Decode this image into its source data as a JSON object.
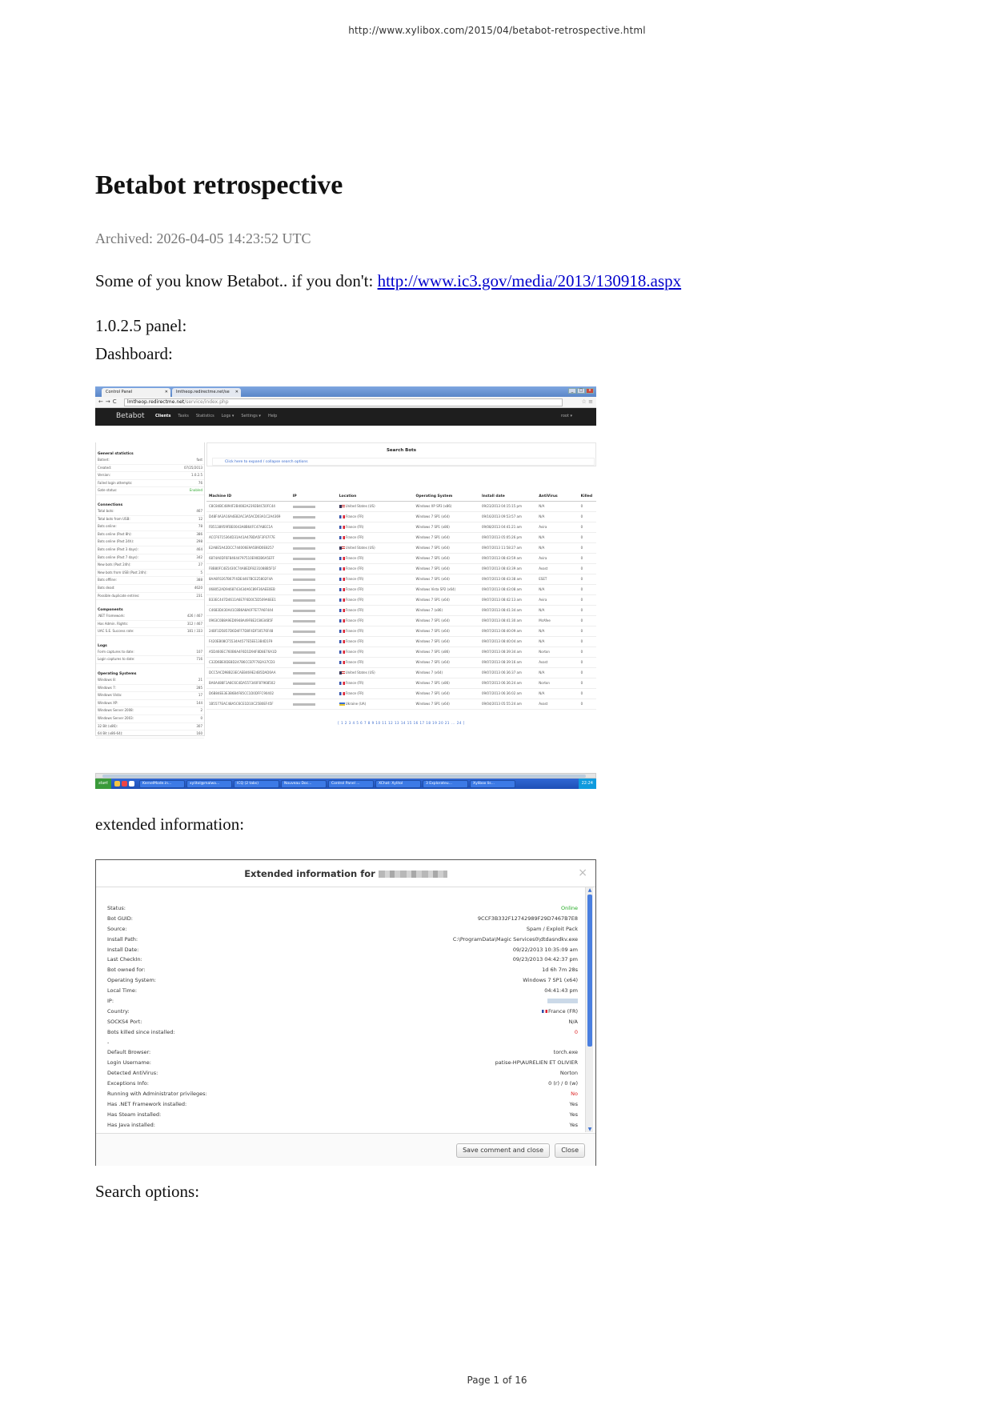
{
  "page": {
    "url": "http://www.xylibox.com/2015/04/betabot-retrospective.html",
    "footer": "Page 1 of 16"
  },
  "article": {
    "title": "Betabot retrospective",
    "archived": "Archived: 2026-04-05 14:23:52 UTC",
    "intro_text": "Some of you know Betabot.. if you don't: ",
    "intro_link": "http://www.ic3.gov/media/2013/130918.aspx",
    "panel_label": "1.0.2.5 panel:",
    "dashboard_label": "Dashboard:",
    "extended_label": "extended information:",
    "search_label": "Search options:"
  },
  "dashboard": {
    "tabs": [
      "Control Panel",
      "lmtheop.redirectme.net/se"
    ],
    "address_host": "lmtheop.redirectme.net",
    "address_path": "/service/index.php",
    "brand": "Betabot",
    "menu": [
      "Clients",
      "Tasks",
      "Statistics",
      "Logs ▾",
      "Settings ▾",
      "Help"
    ],
    "user": "root ▾",
    "stats": [
      {
        "heading": "General statistics",
        "rows": [
          [
            "Botnet:",
            "fast"
          ],
          [
            "Created:",
            "07/25/2013"
          ],
          [
            "Version:",
            "1.0.2.5"
          ],
          [
            "Failed login attempts:",
            "76"
          ],
          [
            "Gate status:",
            "Enabled"
          ]
        ]
      },
      {
        "heading": "Connections",
        "rows": [
          [
            "Total bots:",
            "467"
          ],
          [
            "Total bots from USB:",
            "12"
          ],
          [
            "Bots online:",
            "78"
          ],
          [
            "Bots online (Past 8h):",
            "386"
          ],
          [
            "Bots online (Past 24h):",
            "298"
          ],
          [
            "Bots online (Past 3 days):",
            "464"
          ],
          [
            "Bots online (Past 7 days):",
            "342"
          ],
          [
            "New bots (Past 24h):",
            "27"
          ],
          [
            "New bots from USB (Past 24h):",
            "5"
          ],
          [
            "Bots offline:",
            "388"
          ],
          [
            "Bots dead:",
            "4620"
          ],
          [
            "Possible duplicate entries:",
            "231"
          ]
        ]
      },
      {
        "heading": "Components",
        "rows": [
          [
            ".NET Framework:",
            "426 / 467"
          ],
          [
            "Has Admin. Rights:",
            "312 / 467"
          ],
          [
            "UAC S.E. Success rate:",
            "181 / 333"
          ]
        ]
      },
      {
        "heading": "Logs",
        "rows": [
          [
            "Form captures to date:",
            "107"
          ],
          [
            "Login captures to date:",
            "716"
          ]
        ]
      },
      {
        "heading": "Operating Systems",
        "rows": [
          [
            "Windows 8:",
            "21"
          ],
          [
            "Windows 7:",
            "285"
          ],
          [
            "Windows Vista:",
            "17"
          ],
          [
            "Windows XP:",
            "144"
          ],
          [
            "Windows Server 2008:",
            "2"
          ],
          [
            "Windows Server 2003:",
            "0"
          ],
          [
            "32 Bit (x86):",
            "307"
          ],
          [
            "64 Bit (x86-64):",
            "160"
          ]
        ]
      }
    ],
    "search_title": "Search Bots",
    "search_link": "Click here to expand / collapse search options",
    "columns": [
      "Machine ID",
      "IP",
      "Location",
      "Operating System",
      "Install date",
      "AntiVirus",
      "Killed"
    ],
    "rows": [
      {
        "id": "C8C84BC4894F2B4082A2392B4C50FC44",
        "flag": "us",
        "loc": "United States (US)",
        "os": "Windows XP SP3 (x86)",
        "date": "09/23/2013 04:15:15 pm",
        "av": "N/A",
        "killed": "0"
      },
      {
        "id": "D48F4A3A16A4E82AC3A5ACD03A1C2A4369",
        "flag": "fr",
        "loc": "France (FR)",
        "os": "Windows 7 SP1 (x64)",
        "date": "09/16/2013 09:53:57 am",
        "av": "N/A",
        "killed": "0"
      },
      {
        "id": "FB5138959FBE0043A8B64FC47A8EC1A",
        "flag": "fr",
        "loc": "France (FR)",
        "os": "Windows 7 SP1 (x86)",
        "date": "09/08/2013 04:41:21 am",
        "av": "Avira",
        "killed": "0"
      },
      {
        "id": "ACCF6715364D31A41A47BDA5F3F67F7E",
        "flag": "fr",
        "loc": "France (FR)",
        "os": "Windows 7 SP1 (x64)",
        "date": "09/07/2013 05:05:26 pm",
        "av": "N/A",
        "killed": "0"
      },
      {
        "id": "E2A8E5A42DCC744006E9A5B9D0E8257",
        "flag": "us",
        "loc": "United States (US)",
        "os": "Windows 7 SP1 (x64)",
        "date": "09/07/2013 11:58:27 am",
        "av": "N/A",
        "killed": "0"
      },
      {
        "id": "6874A0DF6F84644797510E90DB6A5EFF",
        "flag": "fr",
        "loc": "France (FR)",
        "os": "Windows 7 SP1 (x64)",
        "date": "09/07/2013 08:43:59 am",
        "av": "Avira",
        "killed": "0"
      },
      {
        "id": "F8B80FC4E5430C74A8EDF8231088B5F1F",
        "flag": "fr",
        "loc": "France (FR)",
        "os": "Windows 7 SP1 (x64)",
        "date": "09/07/2013 08:43:39 am",
        "av": "Avast",
        "killed": "0"
      },
      {
        "id": "8AA8F0267B67F4DE4467BCE25802F4A",
        "flag": "fr",
        "loc": "France (FR)",
        "os": "Windows 7 SP1 (x64)",
        "date": "09/07/2013 08:43:38 am",
        "av": "ESET",
        "killed": "0"
      },
      {
        "id": "068052AD9468743434A6C89F36AEE0EB",
        "flag": "fr",
        "loc": "France (FR)",
        "os": "Windows Vista SP2 (x64)",
        "date": "09/07/2013 08:43:08 am",
        "av": "N/A",
        "killed": "0"
      },
      {
        "id": "B33EC447D4611A6E7F6D0C5D509A6EE1",
        "flag": "fr",
        "loc": "France (FR)",
        "os": "Windows 7 SP1 (x64)",
        "date": "09/07/2013 08:42:13 am",
        "av": "Avira",
        "killed": "0"
      },
      {
        "id": "C4683D430A41C8B6A8A0F7E77A6F444",
        "flag": "fr",
        "loc": "France (FR)",
        "os": "Windows 7 (x86)",
        "date": "09/07/2013 08:41:34 am",
        "av": "N/A",
        "killed": "0"
      },
      {
        "id": "0963C0B8A9ED0948A49F8E2C8634B5F",
        "flag": "fr",
        "loc": "France (FR)",
        "os": "Windows 7 SP1 (x64)",
        "date": "09/07/2013 08:41:30 am",
        "av": "McAfee",
        "killed": "0"
      },
      {
        "id": "24BF1D5857D6D4FF7D8F4DF50576F48",
        "flag": "fr",
        "loc": "France (FR)",
        "os": "Windows 7 SP1 (x64)",
        "date": "09/07/2013 08:40:09 am",
        "av": "N/A",
        "killed": "0"
      },
      {
        "id": "F420EB08CF5534A4577E5EE13B4D1F9",
        "flag": "fr",
        "loc": "France (FR)",
        "os": "Windows 7 SP1 (x64)",
        "date": "09/07/2013 08:40:04 am",
        "av": "N/A",
        "killed": "0"
      },
      {
        "id": "A5D460EC760B6A4F6D1D94F8D8E76A1D",
        "flag": "fr",
        "loc": "France (FR)",
        "os": "Windows 7 SP1 (x86)",
        "date": "09/07/2013 08:39:34 am",
        "av": "Norton",
        "killed": "0"
      },
      {
        "id": "C32D6BE0DE8D247B6CCB7F782A37CD3",
        "flag": "fr",
        "loc": "France (FR)",
        "os": "Windows 7 SP1 (x64)",
        "date": "09/07/2013 08:39:16 am",
        "av": "Avast",
        "killed": "0"
      },
      {
        "id": "DCC5ACD98B23ECAEB469E24B5DAD6AA",
        "flag": "us",
        "loc": "United States (US)",
        "os": "Windows 7 (x64)",
        "date": "09/07/2013 06:36:37 am",
        "av": "N/A",
        "killed": "0"
      },
      {
        "id": "BA6A488F1A8C6C4DA557340F87968502",
        "flag": "fr",
        "loc": "France (FR)",
        "os": "Windows 7 SP1 (x86)",
        "date": "09/07/2013 06:36:24 am",
        "av": "Norton",
        "killed": "0"
      },
      {
        "id": "D6B84EE3E3B6B4F85CC1D0DFFC90402",
        "flag": "fr",
        "loc": "France (FR)",
        "os": "Windows 7 SP1 (x64)",
        "date": "09/07/2013 06:36:02 am",
        "av": "N/A",
        "killed": "0"
      },
      {
        "id": "1B5577EAC48A5C6CE1D10C25B0EF45F",
        "flag": "ua",
        "loc": "Ukraine (UA)",
        "os": "Windows 7 SP1 (x64)",
        "date": "09/04/2013 05:55:24 am",
        "av": "Avast",
        "killed": "0"
      }
    ],
    "pagination": "[ 1 2 3 4 5 6 7 8 9 10 11 12 13 14 15 16 17 18 19 20 21 ... 24 ]",
    "taskbar_items": [
      "KernelMode.in...",
      "xylitol@malwa...",
      "ICQ (2 tabs)",
      "Nouveau Doc...",
      "Control Panel ...",
      "XChat: Xylitol",
      "3 Explorateu...",
      "Xylibox&nbsp;lis..."
    ],
    "start_label": "start",
    "clock": "22:24"
  },
  "extended": {
    "title": "Extended information for",
    "rows": [
      {
        "label": "Status:",
        "value": "Online",
        "tone": "green"
      },
      {
        "label": "Bot GUID:",
        "value": "9CCF3B332F12742989F29D7467B7E8",
        "tone": ""
      },
      {
        "label": "Source:",
        "value": "Spam / Exploit Pack",
        "tone": ""
      },
      {
        "label": "Install Path:",
        "value": "C:\\ProgramData\\Magic Services0\\dtdasndkv.exe",
        "tone": ""
      },
      {
        "label": "Install Date:",
        "value": "09/22/2013 10:35:09 am",
        "tone": ""
      },
      {
        "label": "Last CheckIn:",
        "value": "09/23/2013 04:42:37 pm",
        "tone": ""
      },
      {
        "label": "Bot owned for:",
        "value": "1d 6h 7m 28s",
        "tone": ""
      },
      {
        "label": "Operating System:",
        "value": "Windows 7 SP1 (x64)",
        "tone": ""
      },
      {
        "label": "Local Time:",
        "value": "04:41:43 pm",
        "tone": ""
      },
      {
        "label": "IP:",
        "value": "",
        "tone": "ip"
      },
      {
        "label": "Country:",
        "value": "France (FR)",
        "tone": "flag"
      },
      {
        "label": "SOCKS4 Port:",
        "value": "N/A",
        "tone": ""
      },
      {
        "label": "Bots killed since installed:",
        "value": "0",
        "tone": "red"
      },
      {
        "label": "-",
        "value": "",
        "tone": ""
      },
      {
        "label": "Default Browser:",
        "value": "torch.exe",
        "tone": ""
      },
      {
        "label": "Login Username:",
        "value": "patise-HP\\AURELIEN ET OLIVIER",
        "tone": ""
      },
      {
        "label": "Detected AntiVirus:",
        "value": "Norton",
        "tone": ""
      },
      {
        "label": "Exceptions Info:",
        "value": "0 (r) / 0 (w)",
        "tone": ""
      },
      {
        "label": "Running with Administrator privileges:",
        "value": "No",
        "tone": "red"
      },
      {
        "label": "Has .NET Framework installed:",
        "value": "Yes",
        "tone": ""
      },
      {
        "label": "Has Steam installed:",
        "value": "Yes",
        "tone": ""
      },
      {
        "label": "Has Java installed:",
        "value": "Yes",
        "tone": ""
      }
    ],
    "save_button": "Save comment and close",
    "close_button": "Close"
  }
}
